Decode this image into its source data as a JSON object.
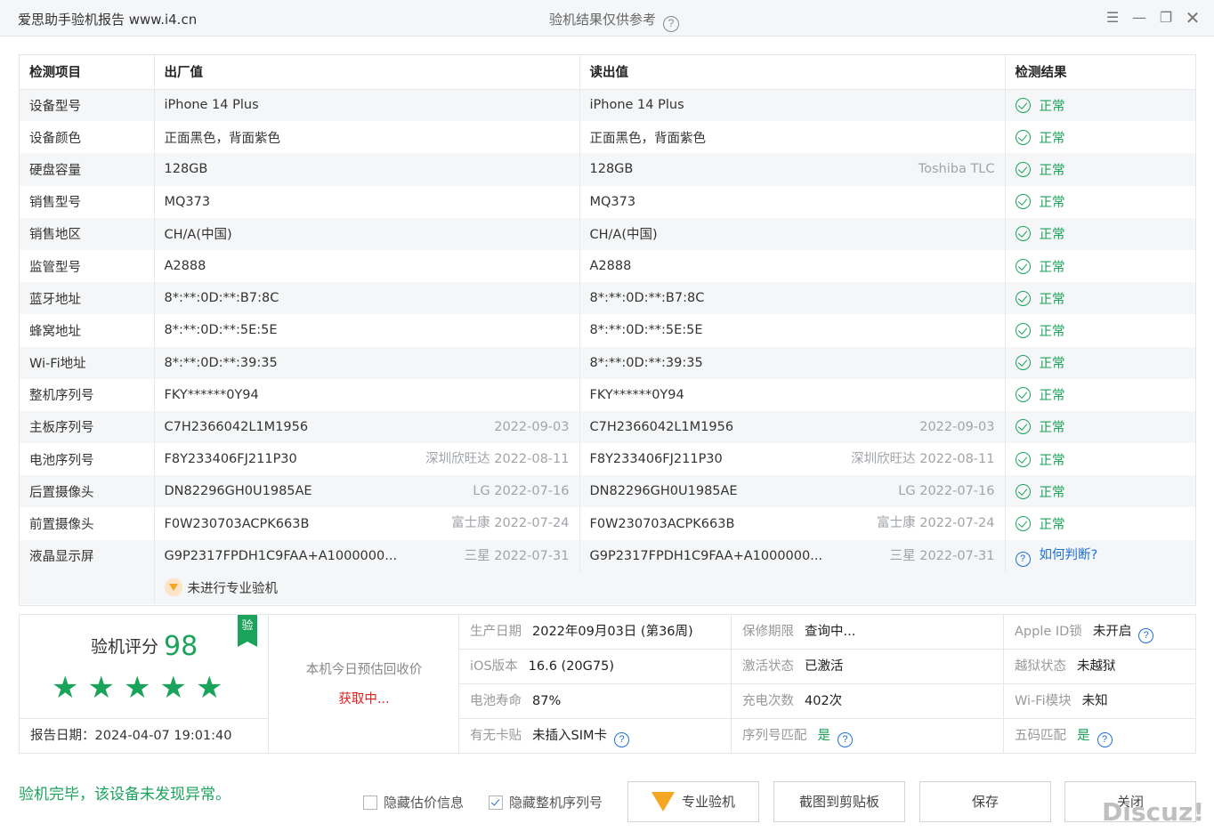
{
  "titlebar": {
    "app_title": "爱思助手验机报告 www.i4.cn",
    "center_title": "验机结果仅供参考",
    "help_icon": "question-circle-icon",
    "controls": [
      "menu-icon",
      "minimize-icon",
      "restore-icon",
      "close-icon"
    ]
  },
  "table": {
    "headers": [
      "检测项目",
      "出厂值",
      "读出值",
      "检测结果"
    ],
    "rows": [
      {
        "item": "设备型号",
        "factory": "iPhone 14 Plus",
        "factory_extra": "",
        "read": "iPhone 14 Plus",
        "read_extra": "",
        "result": "正常",
        "status": "ok"
      },
      {
        "item": "设备颜色",
        "factory": "正面黑色，背面紫色",
        "factory_extra": "",
        "read": "正面黑色，背面紫色",
        "read_extra": "",
        "result": "正常",
        "status": "ok"
      },
      {
        "item": "硬盘容量",
        "factory": "128GB",
        "factory_extra": "",
        "read": "128GB",
        "read_extra": "Toshiba TLC",
        "result": "正常",
        "status": "ok"
      },
      {
        "item": "销售型号",
        "factory": "MQ373",
        "factory_extra": "",
        "read": "MQ373",
        "read_extra": "",
        "result": "正常",
        "status": "ok"
      },
      {
        "item": "销售地区",
        "factory": "CH/A(中国)",
        "factory_extra": "",
        "read": "CH/A(中国)",
        "read_extra": "",
        "result": "正常",
        "status": "ok"
      },
      {
        "item": "监管型号",
        "factory": "A2888",
        "factory_extra": "",
        "read": "A2888",
        "read_extra": "",
        "result": "正常",
        "status": "ok"
      },
      {
        "item": "蓝牙地址",
        "factory": "8*:**:0D:**:B7:8C",
        "factory_extra": "",
        "read": "8*:**:0D:**:B7:8C",
        "read_extra": "",
        "result": "正常",
        "status": "ok"
      },
      {
        "item": "蜂窝地址",
        "factory": "8*:**:0D:**:5E:5E",
        "factory_extra": "",
        "read": "8*:**:0D:**:5E:5E",
        "read_extra": "",
        "result": "正常",
        "status": "ok"
      },
      {
        "item": "Wi-Fi地址",
        "factory": "8*:**:0D:**:39:35",
        "factory_extra": "",
        "read": "8*:**:0D:**:39:35",
        "read_extra": "",
        "result": "正常",
        "status": "ok"
      },
      {
        "item": "整机序列号",
        "factory": "FKY******0Y94",
        "factory_extra": "",
        "read": "FKY******0Y94",
        "read_extra": "",
        "result": "正常",
        "status": "ok"
      },
      {
        "item": "主板序列号",
        "factory": "C7H2366042L1M1956",
        "factory_extra": "2022-09-03",
        "read": "C7H2366042L1M1956",
        "read_extra": "2022-09-03",
        "result": "正常",
        "status": "ok"
      },
      {
        "item": "电池序列号",
        "factory": "F8Y233406FJ211P30",
        "factory_extra": "深圳欣旺达 2022-08-11",
        "read": "F8Y233406FJ211P30",
        "read_extra": "深圳欣旺达 2022-08-11",
        "result": "正常",
        "status": "ok"
      },
      {
        "item": "后置摄像头",
        "factory": "DN82296GH0U1985AE",
        "factory_extra": "LG 2022-07-16",
        "read": "DN82296GH0U1985AE",
        "read_extra": "LG 2022-07-16",
        "result": "正常",
        "status": "ok"
      },
      {
        "item": "前置摄像头",
        "factory": "F0W230703ACPK663B",
        "factory_extra": "富士康 2022-07-24",
        "read": "F0W230703ACPK663B",
        "read_extra": "富士康 2022-07-24",
        "result": "正常",
        "status": "ok"
      },
      {
        "item": "液晶显示屏",
        "factory": "G9P2317FPDH1C9FAA+A1000000...",
        "factory_extra": "三星 2022-07-31",
        "read": "G9P2317FPDH1C9FAA+A1000000...",
        "read_extra": "三星 2022-07-31",
        "result": "如何判断?",
        "status": "question"
      }
    ],
    "pro_note": "未进行专业验机"
  },
  "summary": {
    "score_label": "验机评分",
    "score": "98",
    "verify_tag": "验",
    "stars": 5,
    "report_date": "报告日期：2024-04-07 19:01:40",
    "price_label": "本机今日预估回收价",
    "price_value": "获取中...",
    "info": [
      {
        "k": "生产日期",
        "v": "2022年09月03日 (第36周)",
        "style": "v",
        "help": false
      },
      {
        "k": "保修期限",
        "v": "查询中...",
        "style": "v",
        "help": false
      },
      {
        "k": "Apple ID锁",
        "v": "未开启",
        "style": "v",
        "help": true
      },
      {
        "k": "iOS版本",
        "v": "16.6 (20G75)",
        "style": "v",
        "help": false
      },
      {
        "k": "激活状态",
        "v": "已激活",
        "style": "v",
        "help": false
      },
      {
        "k": "越狱状态",
        "v": "未越狱",
        "style": "v",
        "help": false
      },
      {
        "k": "电池寿命",
        "v": "87%",
        "style": "v",
        "help": false
      },
      {
        "k": "充电次数",
        "v": "402次",
        "style": "v",
        "help": false
      },
      {
        "k": "Wi-Fi模块",
        "v": "未知",
        "style": "v",
        "help": false
      },
      {
        "k": "有无卡贴",
        "v": "未插入SIM卡",
        "style": "v",
        "help": true
      },
      {
        "k": "序列号匹配",
        "v": "是",
        "style": "g",
        "help": true
      },
      {
        "k": "五码匹配",
        "v": "是",
        "style": "g",
        "help": true
      }
    ]
  },
  "bottom": {
    "message": "验机完毕，该设备未发现异常。",
    "hide_price_label": "隐藏估价信息",
    "hide_price_checked": false,
    "hide_serial_label": "隐藏整机序列号",
    "hide_serial_checked": true,
    "btn_pro": "专业验机",
    "btn_copy": "截图到剪贴板",
    "btn_save": "保存",
    "btn_close": "关闭",
    "watermark": "Discuz!"
  },
  "colors": {
    "ok": "#1aa35a",
    "link": "#1e6fd6",
    "warn": "#e02020",
    "accent_orange": "#f5a623"
  }
}
